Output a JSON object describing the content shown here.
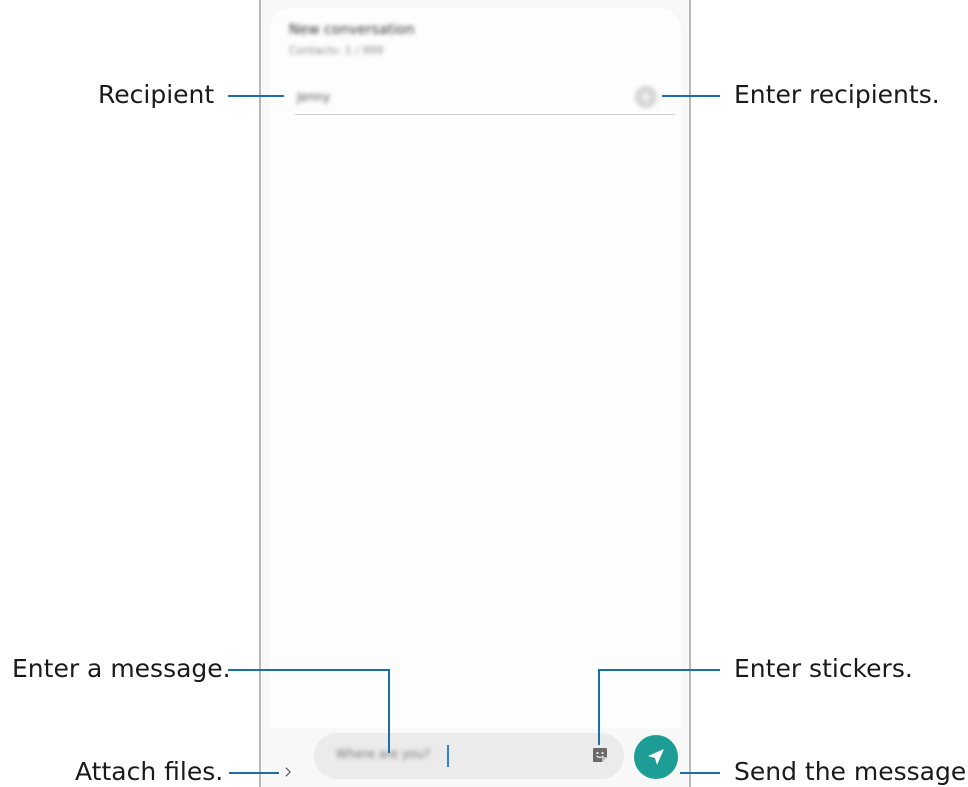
{
  "app": {
    "title": "New conversation",
    "subtitle": "Contacts: 1 / 999"
  },
  "recipient": {
    "value": "Jenny",
    "add_icon": "plus-circle-icon"
  },
  "composer": {
    "attach_icon": "chevron-right-icon",
    "message_value": "Where are you?",
    "sticker_icon": "sticker-icon",
    "send_icon": "send-icon",
    "send_color": "#1e9d96"
  },
  "callouts": {
    "recipient": "Recipient",
    "enter_recipients": "Enter recipients.",
    "enter_message": "Enter a message.",
    "attach_files": "Attach files.",
    "enter_stickers": "Enter stickers.",
    "send_message": "Send the message."
  },
  "colors": {
    "callout_line": "#1b6fa8",
    "send_button": "#1e9d96",
    "caret": "#2d7fd0"
  }
}
